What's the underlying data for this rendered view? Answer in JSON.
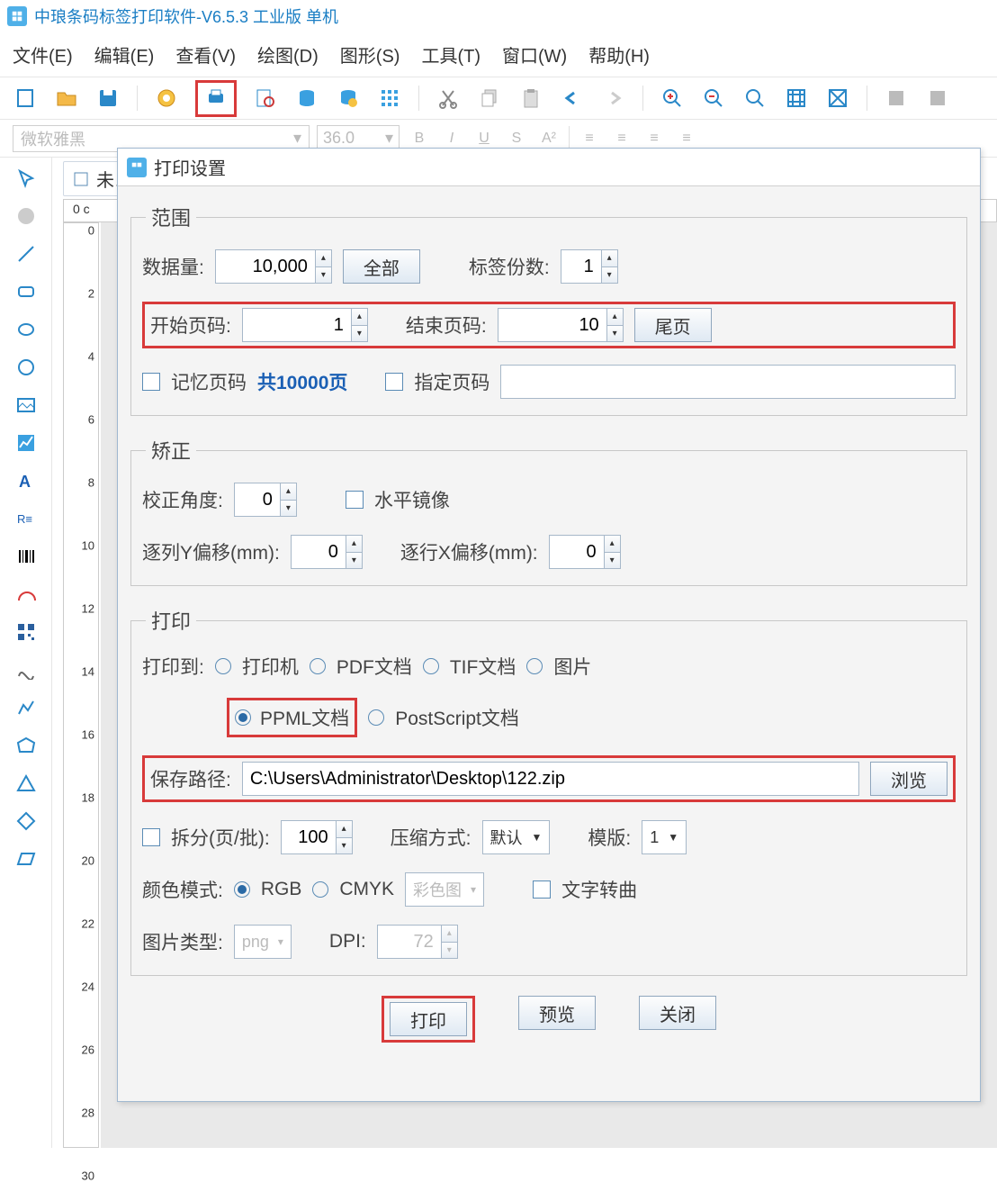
{
  "app": {
    "title": "中琅条码标签打印软件-V6.5.3 工业版 单机"
  },
  "menu": {
    "file": "文件(E)",
    "edit": "编辑(E)",
    "view": "查看(V)",
    "draw": "绘图(D)",
    "shape": "图形(S)",
    "tool": "工具(T)",
    "window": "窗口(W)",
    "help": "帮助(H)"
  },
  "format": {
    "font": "微软雅黑",
    "size": "36.0"
  },
  "docTab": {
    "name": "未…"
  },
  "rulerV": [
    "0",
    "2",
    "4",
    "6",
    "8",
    "10",
    "12",
    "14",
    "16",
    "18",
    "20",
    "22",
    "24",
    "26",
    "28",
    "30"
  ],
  "dialog": {
    "title": "打印设置",
    "range": {
      "legend": "范围",
      "dataCountLabel": "数据量:",
      "dataCount": "10,000",
      "allBtn": "全部",
      "copiesLabel": "标签份数:",
      "copies": "1",
      "startLabel": "开始页码:",
      "start": "1",
      "endLabel": "结束页码:",
      "end": "10",
      "lastPageBtn": "尾页",
      "rememberPage": "记忆页码",
      "totalPages": "共10000页",
      "specifyPage": "指定页码",
      "specifyInput": ""
    },
    "correct": {
      "legend": "矫正",
      "angleLabel": "校正角度:",
      "angle": "0",
      "mirror": "水平镜像",
      "yOffLabel": "逐列Y偏移(mm):",
      "yOff": "0",
      "xOffLabel": "逐行X偏移(mm):",
      "xOff": "0"
    },
    "print": {
      "legend": "打印",
      "toLabel": "打印到:",
      "printer": "打印机",
      "pdf": "PDF文档",
      "tif": "TIF文档",
      "img": "图片",
      "ppml": "PPML文档",
      "ps": "PostScript文档",
      "savePathLabel": "保存路径:",
      "savePath": "C:\\Users\\Administrator\\Desktop\\122.zip",
      "browse": "浏览",
      "splitLabel": "拆分(页/批):",
      "split": "100",
      "compressLabel": "压缩方式:",
      "compressSel": "默认",
      "templateLabel": "模版:",
      "templateSel": "1",
      "colorLabel": "颜色模式:",
      "rgb": "RGB",
      "cmyk": "CMYK",
      "colorSel": "彩色图",
      "textCurve": "文字转曲",
      "imgTypeLabel": "图片类型:",
      "imgTypeSel": "png",
      "dpiLabel": "DPI:",
      "dpi": "72"
    },
    "buttons": {
      "print": "打印",
      "preview": "预览",
      "close": "关闭"
    }
  }
}
